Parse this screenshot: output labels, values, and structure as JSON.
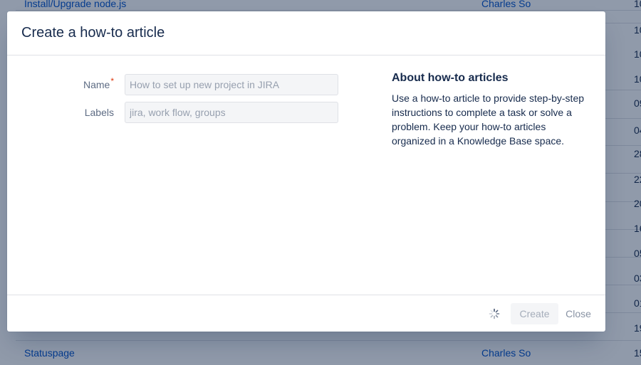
{
  "background": {
    "rows": [
      {
        "title": "Install/Upgrade node.js",
        "author": "Charles So",
        "num": "10"
      },
      {
        "title": "Statuspage",
        "author": "Charles So",
        "num": "15"
      }
    ],
    "side_numbers": [
      "10",
      "10",
      "10",
      "09",
      "04",
      "28",
      "22",
      "20",
      "16",
      "05",
      "03",
      "01",
      "19"
    ]
  },
  "dialog": {
    "title": "Create a how-to article",
    "fields": {
      "name": {
        "label": "Name",
        "required_marker": "*",
        "placeholder": "How to set up new project in JIRA",
        "value": ""
      },
      "labels": {
        "label": "Labels",
        "placeholder": "jira, work flow, groups",
        "value": ""
      }
    },
    "help": {
      "title": "About how-to articles",
      "text": "Use a how-to article to provide step-by-step instructions to complete a task or solve a problem. Keep your how-to articles organized in a Knowledge Base space."
    },
    "footer": {
      "spinner_icon": "loading-spinner-icon",
      "create_label": "Create",
      "close_label": "Close"
    }
  },
  "colors": {
    "link": "#0052cc",
    "text": "#172b4d",
    "muted": "#5e6c84",
    "required": "#de350b",
    "overlay": "rgba(9, 30, 66, 0.45)"
  }
}
